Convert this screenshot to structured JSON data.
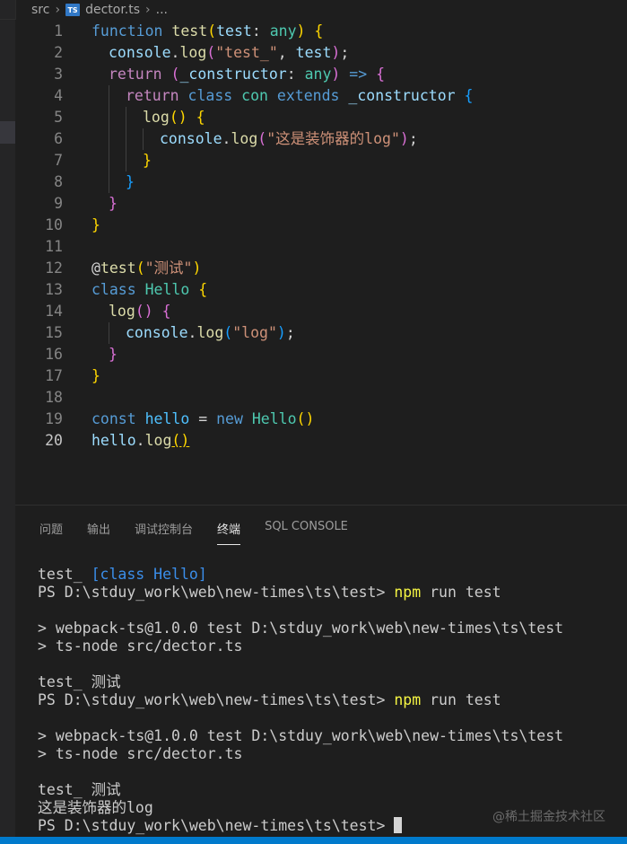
{
  "breadcrumb": {
    "folder": "src",
    "file_badge": "TS",
    "file": "dector.ts",
    "more": "..."
  },
  "editor": {
    "active_line": 20,
    "lines": [
      {
        "no": "1",
        "indent": 0,
        "tokens": [
          [
            "kw",
            "function"
          ],
          [
            "p",
            " "
          ],
          [
            "fn",
            "test"
          ],
          [
            "br1",
            "("
          ],
          [
            "var",
            "test"
          ],
          [
            "p",
            ": "
          ],
          [
            "type",
            "any"
          ],
          [
            "br1",
            ")"
          ],
          [
            "p",
            " "
          ],
          [
            "br1",
            "{"
          ]
        ]
      },
      {
        "no": "2",
        "indent": 1,
        "tokens": [
          [
            "var",
            "console"
          ],
          [
            "p",
            "."
          ],
          [
            "fn",
            "log"
          ],
          [
            "br2",
            "("
          ],
          [
            "str",
            "\"test_\""
          ],
          [
            "p",
            ", "
          ],
          [
            "var",
            "test"
          ],
          [
            "br2",
            ")"
          ],
          [
            "p",
            ";"
          ]
        ]
      },
      {
        "no": "3",
        "indent": 1,
        "tokens": [
          [
            "ctrl",
            "return"
          ],
          [
            "p",
            " "
          ],
          [
            "br2",
            "("
          ],
          [
            "var",
            "_constructor"
          ],
          [
            "p",
            ": "
          ],
          [
            "type",
            "any"
          ],
          [
            "br2",
            ")"
          ],
          [
            "p",
            " "
          ],
          [
            "kw",
            "=>"
          ],
          [
            "p",
            " "
          ],
          [
            "br2",
            "{"
          ]
        ]
      },
      {
        "no": "4",
        "indent": 2,
        "tokens": [
          [
            "ctrl",
            "return"
          ],
          [
            "p",
            " "
          ],
          [
            "kw",
            "class"
          ],
          [
            "p",
            " "
          ],
          [
            "cls",
            "con"
          ],
          [
            "p",
            " "
          ],
          [
            "kw",
            "extends"
          ],
          [
            "p",
            " "
          ],
          [
            "var",
            "_constructor"
          ],
          [
            "p",
            " "
          ],
          [
            "br3",
            "{"
          ]
        ]
      },
      {
        "no": "5",
        "indent": 3,
        "tokens": [
          [
            "fn",
            "log"
          ],
          [
            "br1",
            "()"
          ],
          [
            "p",
            " "
          ],
          [
            "br1",
            "{"
          ]
        ]
      },
      {
        "no": "6",
        "indent": 4,
        "tokens": [
          [
            "var",
            "console"
          ],
          [
            "p",
            "."
          ],
          [
            "fn",
            "log"
          ],
          [
            "br2",
            "("
          ],
          [
            "str",
            "\"这是装饰器的log\""
          ],
          [
            "br2",
            ")"
          ],
          [
            "p",
            ";"
          ]
        ]
      },
      {
        "no": "7",
        "indent": 3,
        "tokens": [
          [
            "br1",
            "}"
          ]
        ]
      },
      {
        "no": "8",
        "indent": 2,
        "tokens": [
          [
            "br3",
            "}"
          ]
        ]
      },
      {
        "no": "9",
        "indent": 1,
        "tokens": [
          [
            "br2",
            "}"
          ]
        ]
      },
      {
        "no": "10",
        "indent": 0,
        "tokens": [
          [
            "br1",
            "}"
          ]
        ]
      },
      {
        "no": "11",
        "indent": 0,
        "tokens": []
      },
      {
        "no": "12",
        "indent": 0,
        "tokens": [
          [
            "p",
            "@"
          ],
          [
            "fn",
            "test"
          ],
          [
            "br1",
            "("
          ],
          [
            "str",
            "\"测试\""
          ],
          [
            "br1",
            ")"
          ]
        ]
      },
      {
        "no": "13",
        "indent": 0,
        "tokens": [
          [
            "kw",
            "class"
          ],
          [
            "p",
            " "
          ],
          [
            "cls",
            "Hello"
          ],
          [
            "p",
            " "
          ],
          [
            "br1",
            "{"
          ]
        ]
      },
      {
        "no": "14",
        "indent": 1,
        "tokens": [
          [
            "fn",
            "log"
          ],
          [
            "br2",
            "()"
          ],
          [
            "p",
            " "
          ],
          [
            "br2",
            "{"
          ]
        ]
      },
      {
        "no": "15",
        "indent": 2,
        "tokens": [
          [
            "var",
            "console"
          ],
          [
            "p",
            "."
          ],
          [
            "fn",
            "log"
          ],
          [
            "br3",
            "("
          ],
          [
            "str",
            "\"log\""
          ],
          [
            "br3",
            ")"
          ],
          [
            "p",
            ";"
          ]
        ]
      },
      {
        "no": "16",
        "indent": 1,
        "tokens": [
          [
            "br2",
            "}"
          ]
        ]
      },
      {
        "no": "17",
        "indent": 0,
        "tokens": [
          [
            "br1",
            "}"
          ]
        ]
      },
      {
        "no": "18",
        "indent": 0,
        "tokens": []
      },
      {
        "no": "19",
        "indent": 0,
        "tokens": [
          [
            "kw",
            "const"
          ],
          [
            "p",
            " "
          ],
          [
            "const",
            "hello"
          ],
          [
            "p",
            " "
          ],
          [
            "p",
            "="
          ],
          [
            "p",
            " "
          ],
          [
            "kw",
            "new"
          ],
          [
            "p",
            " "
          ],
          [
            "cls",
            "Hello"
          ],
          [
            "br1",
            "()"
          ]
        ]
      },
      {
        "no": "20",
        "indent": 0,
        "tokens": [
          [
            "var",
            "hello"
          ],
          [
            "p",
            "."
          ],
          [
            "fn",
            "log"
          ],
          [
            "br1u",
            "()"
          ]
        ]
      }
    ]
  },
  "panel": {
    "tabs": [
      {
        "label": "问题",
        "active": false
      },
      {
        "label": "输出",
        "active": false
      },
      {
        "label": "调试控制台",
        "active": false
      },
      {
        "label": "终端",
        "active": true
      },
      {
        "label": "SQL CONSOLE",
        "active": false
      }
    ]
  },
  "terminal": {
    "lines": [
      [
        [
          "t",
          "test_ "
        ],
        [
          "tb",
          "[class Hello]"
        ]
      ],
      [
        [
          "t",
          "PS D:\\stduy_work\\web\\new-times\\ts\\test> "
        ],
        [
          "ty",
          "npm"
        ],
        [
          "t",
          " run test"
        ]
      ],
      [],
      [
        [
          "t",
          "> webpack-ts@1.0.0 test D:\\stduy_work\\web\\new-times\\ts\\test"
        ]
      ],
      [
        [
          "t",
          "> ts-node src/dector.ts"
        ]
      ],
      [],
      [
        [
          "t",
          "test_ 测试"
        ]
      ],
      [
        [
          "t",
          "PS D:\\stduy_work\\web\\new-times\\ts\\test> "
        ],
        [
          "ty",
          "npm"
        ],
        [
          "t",
          " run test"
        ]
      ],
      [],
      [
        [
          "t",
          "> webpack-ts@1.0.0 test D:\\stduy_work\\web\\new-times\\ts\\test"
        ]
      ],
      [
        [
          "t",
          "> ts-node src/dector.ts"
        ]
      ],
      [],
      [
        [
          "t",
          "test_ 测试"
        ]
      ],
      [
        [
          "t",
          "这是装饰器的log"
        ]
      ],
      [
        [
          "t",
          "PS D:\\stduy_work\\web\\new-times\\ts\\test> "
        ],
        [
          "cursor",
          ""
        ]
      ]
    ]
  },
  "watermark": "@稀土掘金技术社区",
  "colors": {
    "kw": "#569cd6",
    "ctrl": "#c586c0",
    "fn": "#dcdcaa",
    "var": "#9cdcfe",
    "type": "#4ec9b0",
    "cls": "#4ec9b0",
    "str": "#ce9178",
    "p": "#d4d4d4",
    "const": "#4fc1ff",
    "br1": "#ffd700",
    "br2": "#da70d6",
    "br3": "#179fff",
    "t": "#cccccc",
    "tb": "#3b8eea",
    "ty": "#f5f543"
  }
}
